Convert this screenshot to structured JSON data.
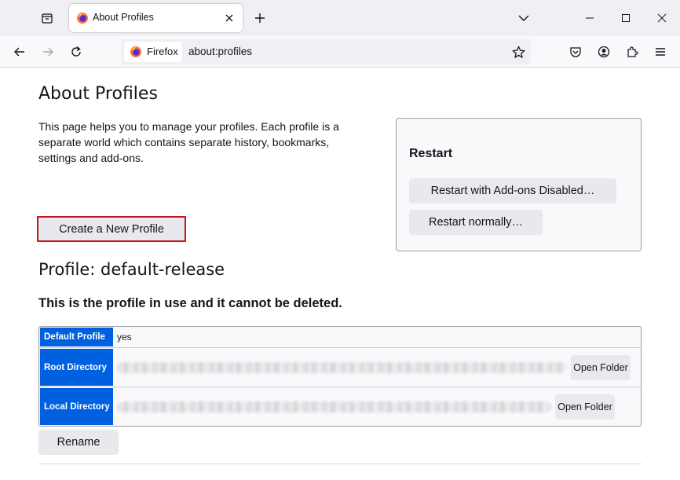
{
  "browser": {
    "tab": {
      "title": "About Profiles"
    },
    "identity_label": "Firefox",
    "url": "about:profiles"
  },
  "page": {
    "title": "About Profiles",
    "intro": "This page helps you to manage your profiles. Each profile is a separate world which contains separate history, bookmarks, settings and add-ons.",
    "create_button": "Create a New Profile",
    "restart": {
      "title": "Restart",
      "addons_disabled_button": "Restart with Add-ons Disabled…",
      "normal_button": "Restart normally…"
    },
    "profile": {
      "heading": "Profile: default-release",
      "note": "This is the profile in use and it cannot be deleted.",
      "rows": [
        {
          "label": "Default Profile",
          "value": "yes"
        },
        {
          "label": "Root Directory",
          "value": "",
          "button": "Open Folder"
        },
        {
          "label": "Local Directory",
          "value": "",
          "button": "Open Folder"
        }
      ],
      "rename_button": "Rename"
    }
  },
  "colors": {
    "accent": "#0061e0",
    "focus_outline": "#c4131c",
    "button_bg": "#e9e9ed",
    "chrome_bg": "#f0f0f4"
  },
  "icons": [
    "tab-list-icon",
    "firefox-logo-icon",
    "close-icon",
    "plus-icon",
    "chevron-down-icon",
    "minimize-icon",
    "maximize-icon",
    "back-icon",
    "forward-icon",
    "reload-icon",
    "star-icon",
    "pocket-icon",
    "account-icon",
    "extensions-icon",
    "menu-icon"
  ]
}
